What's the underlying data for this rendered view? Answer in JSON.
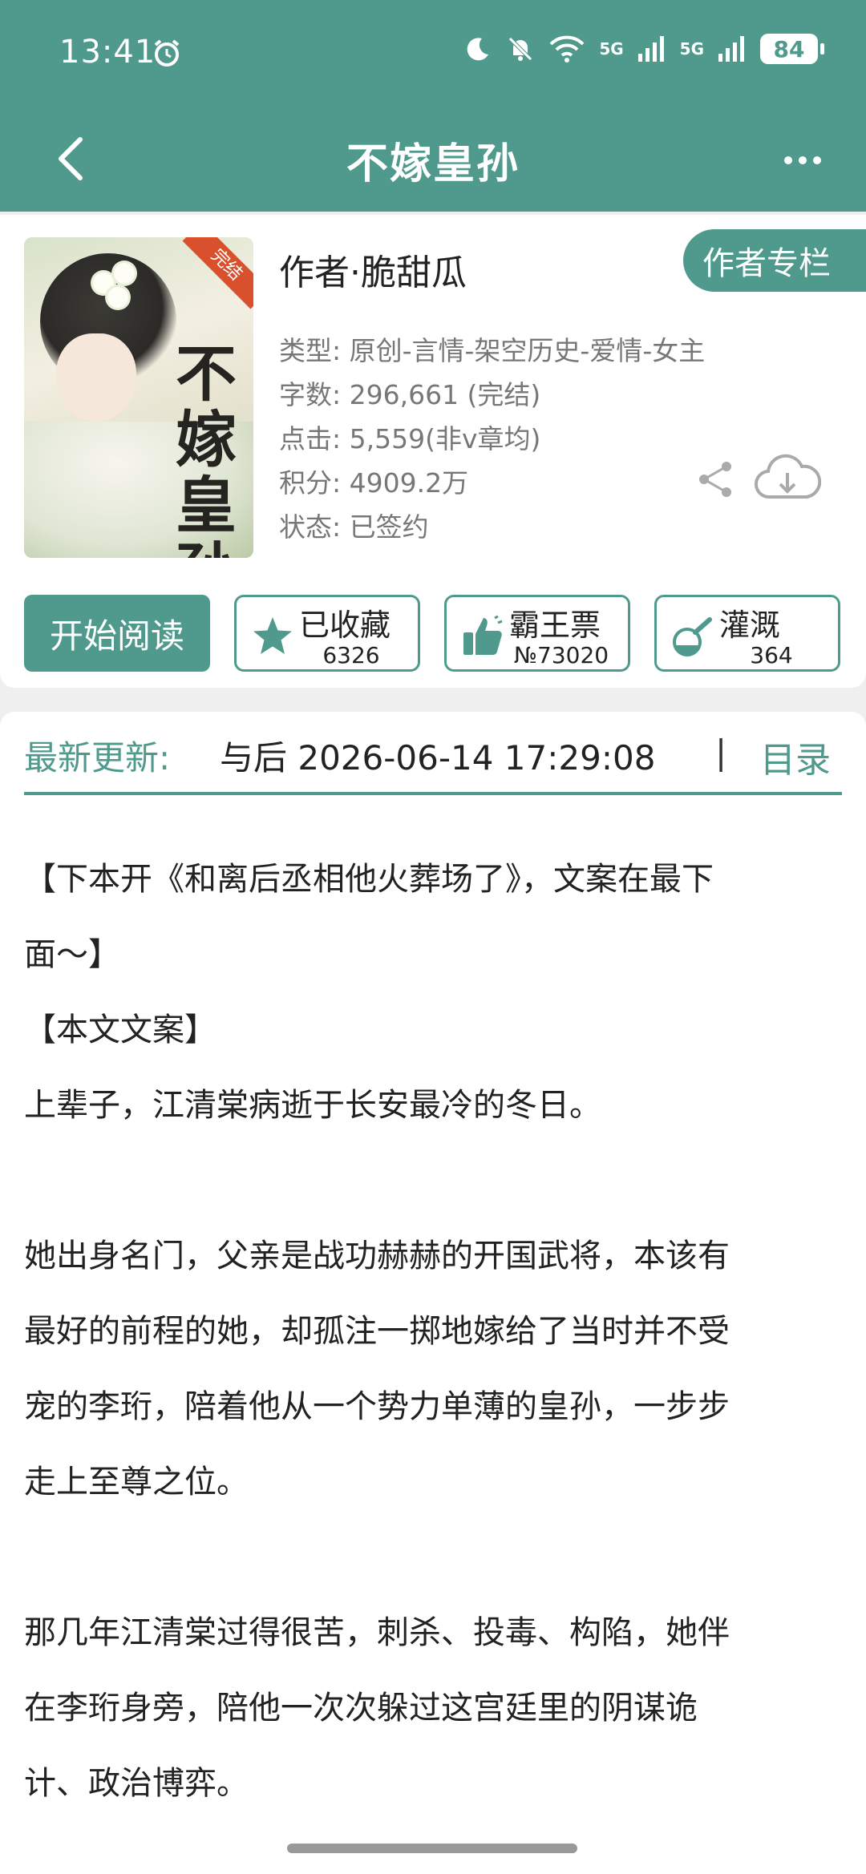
{
  "status_bar": {
    "time": "13:41",
    "battery": "84",
    "net1": "5G",
    "net2": "5G"
  },
  "header": {
    "title": "不嫁皇孙"
  },
  "book": {
    "cover_title": "不嫁皇孙",
    "cover_badge": "完结",
    "author": "作者·脆甜瓜",
    "author_column_label": "作者专栏",
    "meta": [
      "类型: 原创-言情-架空历史-爱情-女主",
      "字数: 296,661 (完结)",
      "点击: 5,559(非v章均)",
      "积分: 4909.2万",
      "状态: 已签约"
    ]
  },
  "actions": {
    "read_label": "开始阅读",
    "favorite": {
      "label": "已收藏",
      "count": "6326"
    },
    "bawang": {
      "label": "霸王票",
      "count": "№73020"
    },
    "guangai": {
      "label": "灌溉",
      "count": "364"
    }
  },
  "update": {
    "label": "最新更新:",
    "text": "与后  2026-06-14 17:29:08",
    "separator": "|",
    "toc_label": "目录"
  },
  "content": [
    "【下本开《和离后丞相他火葬场了》，文案在最下",
    "面～】",
    "【本文文案】",
    "上辈子，江清棠病逝于长安最冷的冬日。",
    "",
    "她出身名门，父亲是战功赫赫的开国武将，本该有",
    "最好的前程的她，却孤注一掷地嫁给了当时并不受",
    "宠的李珩，陪着他从一个势力单薄的皇孙，一步步",
    "走上至尊之位。",
    "",
    "那几年江清棠过得很苦，刺杀、投毒、构陷，她伴",
    "在李珩身旁，陪他一次次躲过这宫廷里的阴谋诡",
    "计、政治博弈。"
  ],
  "colors": {
    "accent": "#4f9a8c",
    "badge": "#d9502c"
  }
}
